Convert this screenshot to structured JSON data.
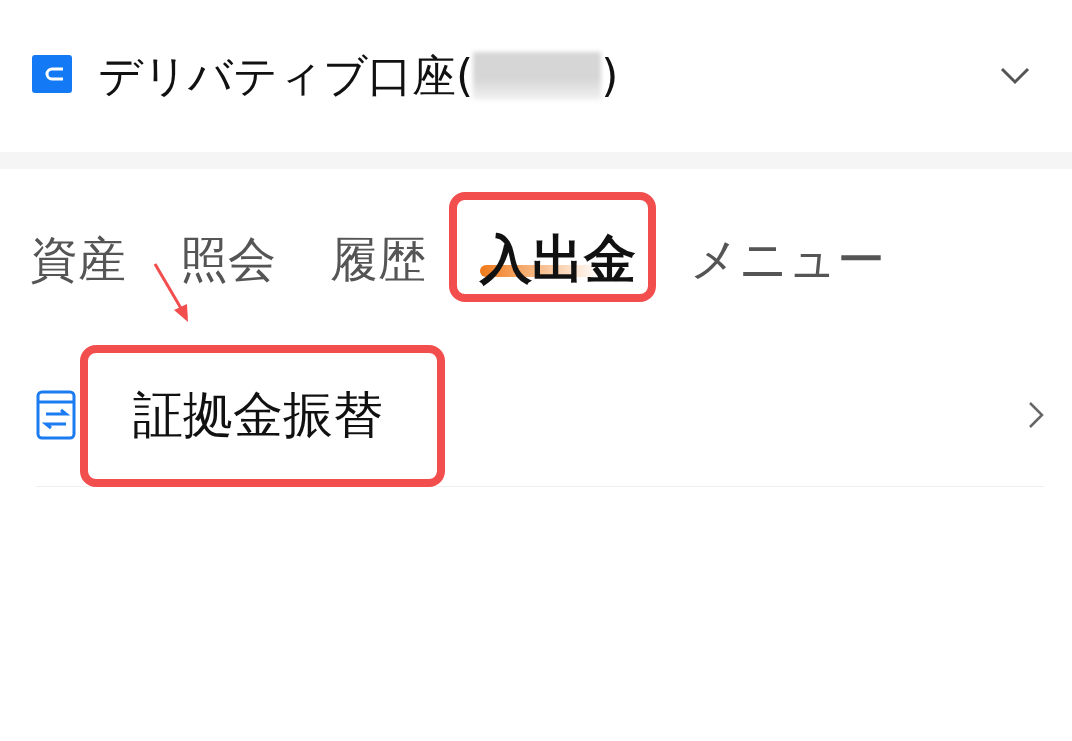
{
  "account": {
    "label": "デリバティブ口座(",
    "label_end": ")",
    "redacted": true
  },
  "tabs": [
    {
      "label": "資産",
      "selected": false,
      "highlighted": false
    },
    {
      "label": "照会",
      "selected": false,
      "highlighted": false
    },
    {
      "label": "履歴",
      "selected": false,
      "highlighted": false
    },
    {
      "label": "入出金",
      "selected": true,
      "highlighted": true
    },
    {
      "label": "メニュー",
      "selected": false,
      "highlighted": false
    }
  ],
  "menu_items": [
    {
      "label": "証拠金振替",
      "highlighted": true
    }
  ]
}
